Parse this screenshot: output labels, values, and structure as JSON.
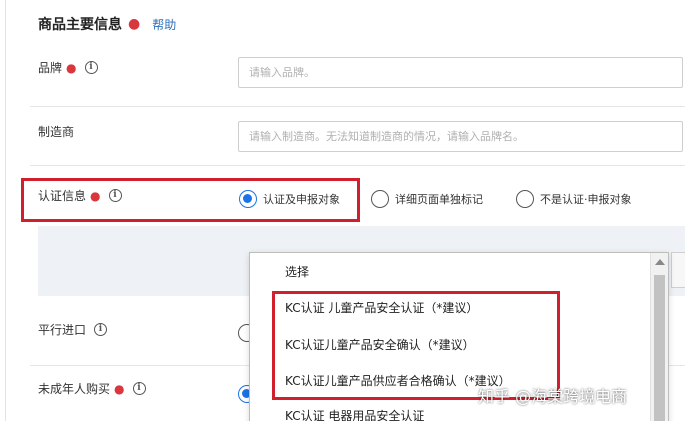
{
  "section": {
    "title": "商品主要信息",
    "help": "帮助"
  },
  "rows": {
    "brand": {
      "label": "品牌",
      "placeholder": "请输入品牌。"
    },
    "manufacturer": {
      "label": "制造商",
      "placeholder": "请输入制造商。无法知道制造商的情况，请输入品牌名。"
    },
    "certification": {
      "label": "认证信息",
      "options": [
        "认证及申报对象",
        "详细页面单独标记",
        "不是认证·申报对象"
      ],
      "selected_index": 0
    },
    "parallel_import": {
      "label": "平行进口"
    },
    "minor_purchase": {
      "label": "未成年人购买"
    }
  },
  "dropdown": {
    "items": [
      "选择",
      "KC认证 儿童产品安全认证（*建议）",
      "KC认证儿童产品安全确认（*建议）",
      "KC认证儿童产品供应者合格确认（*建议）",
      "KC认证 电器用品安全认证"
    ]
  },
  "watermark": "知乎 @海棠跨境电商",
  "colors": {
    "required": "#d9363e",
    "link": "#2d6fb7",
    "accent": "#1a73e8",
    "highlight_box": "#d0202e",
    "panel": "#eef1f5"
  }
}
